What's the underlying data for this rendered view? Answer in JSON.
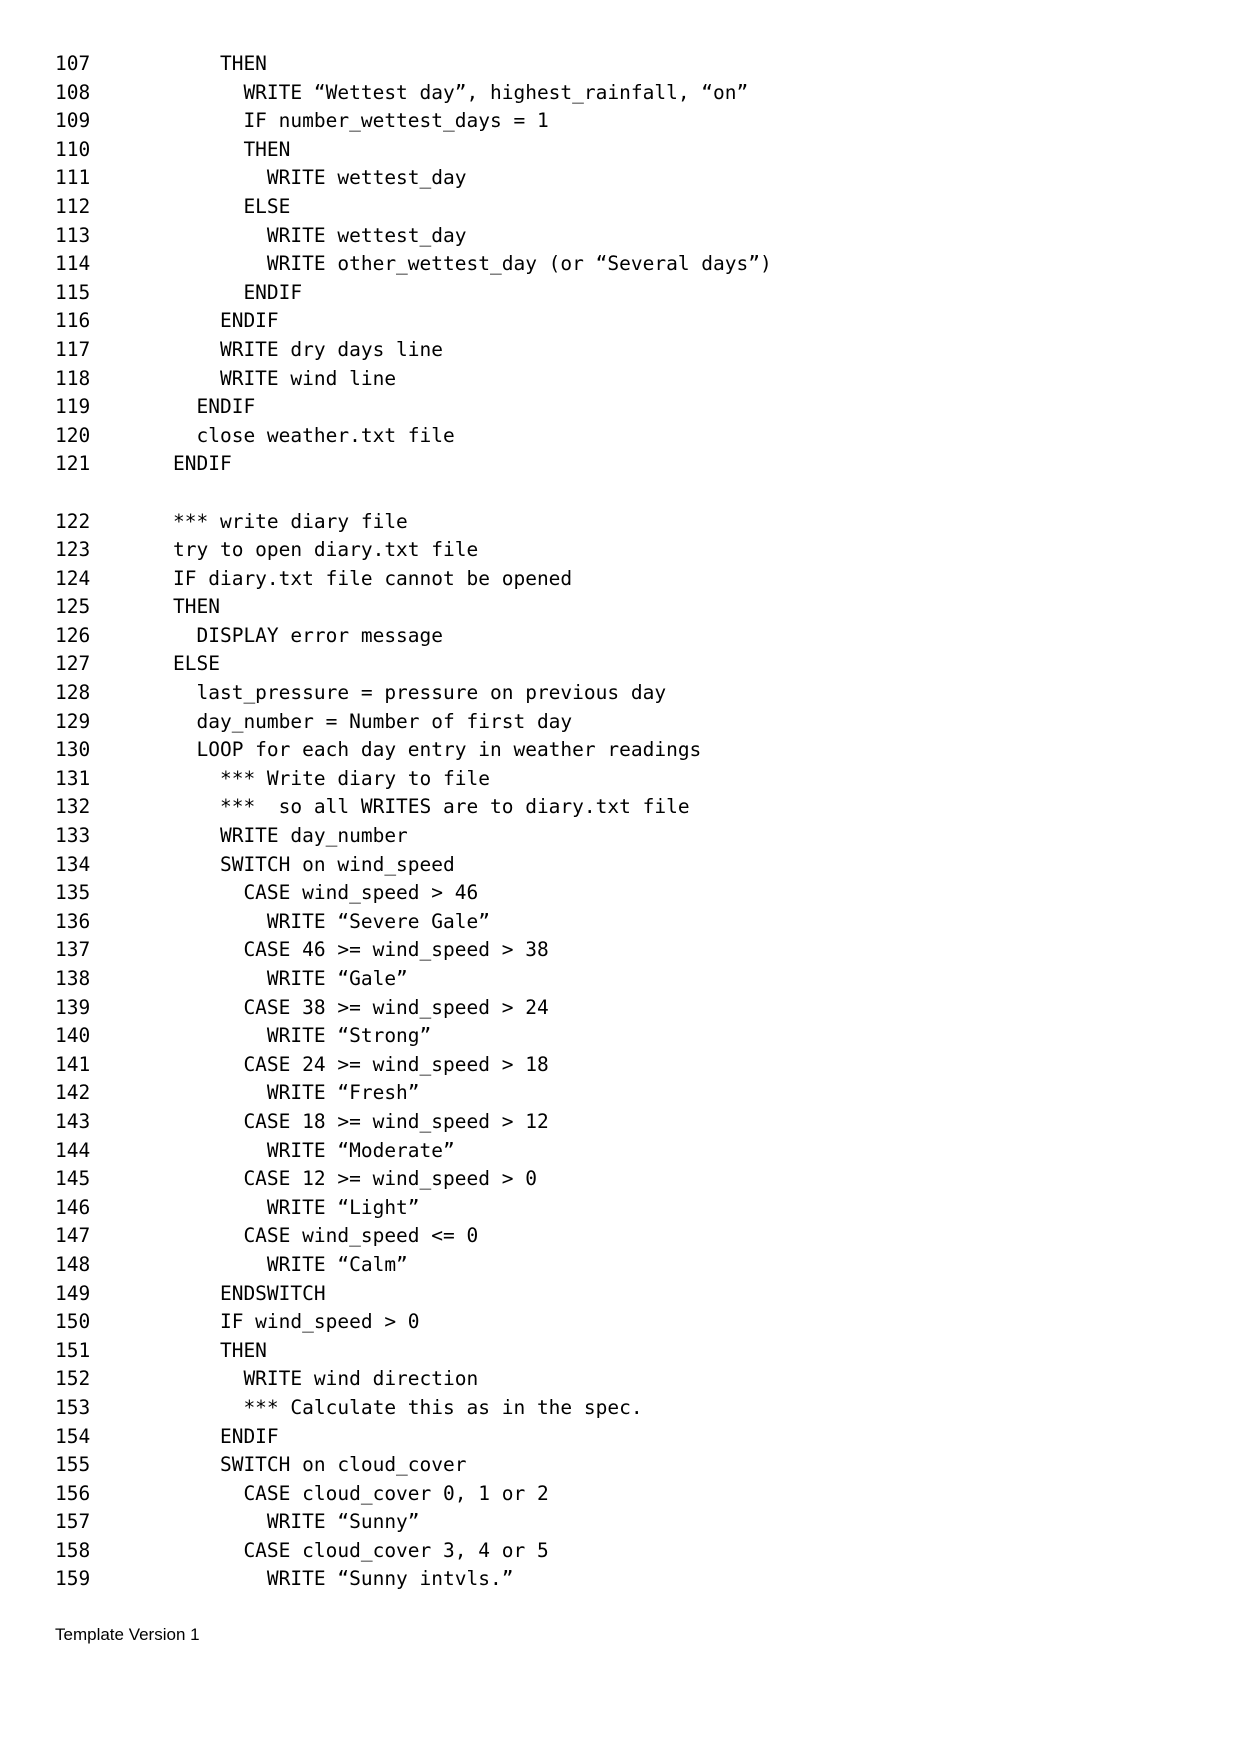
{
  "document": {
    "footer_text": "Template Version 1"
  },
  "listing": {
    "lines": [
      {
        "number": "107",
        "code": "    THEN"
      },
      {
        "number": "108",
        "code": "      WRITE “Wettest day”, highest_rainfall, “on”"
      },
      {
        "number": "109",
        "code": "      IF number_wettest_days = 1"
      },
      {
        "number": "110",
        "code": "      THEN"
      },
      {
        "number": "111",
        "code": "        WRITE wettest_day"
      },
      {
        "number": "112",
        "code": "      ELSE"
      },
      {
        "number": "113",
        "code": "        WRITE wettest_day"
      },
      {
        "number": "114",
        "code": "        WRITE other_wettest_day (or “Several days”)"
      },
      {
        "number": "115",
        "code": "      ENDIF"
      },
      {
        "number": "116",
        "code": "    ENDIF"
      },
      {
        "number": "117",
        "code": "    WRITE dry days line"
      },
      {
        "number": "118",
        "code": "    WRITE wind line"
      },
      {
        "number": "119",
        "code": "  ENDIF"
      },
      {
        "number": "120",
        "code": "  close weather.txt file"
      },
      {
        "number": "121",
        "code": "ENDIF"
      },
      {
        "number": "",
        "code": ""
      },
      {
        "number": "122",
        "code": "*** write diary file"
      },
      {
        "number": "123",
        "code": "try to open diary.txt file"
      },
      {
        "number": "124",
        "code": "IF diary.txt file cannot be opened"
      },
      {
        "number": "125",
        "code": "THEN"
      },
      {
        "number": "126",
        "code": "  DISPLAY error message"
      },
      {
        "number": "127",
        "code": "ELSE"
      },
      {
        "number": "128",
        "code": "  last_pressure = pressure on previous day"
      },
      {
        "number": "129",
        "code": "  day_number = Number of first day"
      },
      {
        "number": "130",
        "code": "  LOOP for each day entry in weather readings"
      },
      {
        "number": "131",
        "code": "    *** Write diary to file"
      },
      {
        "number": "132",
        "code": "    ***  so all WRITES are to diary.txt file"
      },
      {
        "number": "133",
        "code": "    WRITE day_number"
      },
      {
        "number": "134",
        "code": "    SWITCH on wind_speed"
      },
      {
        "number": "135",
        "code": "      CASE wind_speed > 46"
      },
      {
        "number": "136",
        "code": "        WRITE “Severe Gale”"
      },
      {
        "number": "137",
        "code": "      CASE 46 >= wind_speed > 38"
      },
      {
        "number": "138",
        "code": "        WRITE “Gale”"
      },
      {
        "number": "139",
        "code": "      CASE 38 >= wind_speed > 24"
      },
      {
        "number": "140",
        "code": "        WRITE “Strong”"
      },
      {
        "number": "141",
        "code": "      CASE 24 >= wind_speed > 18"
      },
      {
        "number": "142",
        "code": "        WRITE “Fresh”"
      },
      {
        "number": "143",
        "code": "      CASE 18 >= wind_speed > 12"
      },
      {
        "number": "144",
        "code": "        WRITE “Moderate”"
      },
      {
        "number": "145",
        "code": "      CASE 12 >= wind_speed > 0"
      },
      {
        "number": "146",
        "code": "        WRITE “Light”"
      },
      {
        "number": "147",
        "code": "      CASE wind_speed <= 0"
      },
      {
        "number": "148",
        "code": "        WRITE “Calm”"
      },
      {
        "number": "149",
        "code": "    ENDSWITCH"
      },
      {
        "number": "150",
        "code": "    IF wind_speed > 0"
      },
      {
        "number": "151",
        "code": "    THEN"
      },
      {
        "number": "152",
        "code": "      WRITE wind direction"
      },
      {
        "number": "153",
        "code": "      *** Calculate this as in the spec."
      },
      {
        "number": "154",
        "code": "    ENDIF"
      },
      {
        "number": "155",
        "code": "    SWITCH on cloud_cover"
      },
      {
        "number": "156",
        "code": "      CASE cloud_cover 0, 1 or 2"
      },
      {
        "number": "157",
        "code": "        WRITE “Sunny”"
      },
      {
        "number": "158",
        "code": "      CASE cloud_cover 3, 4 or 5"
      },
      {
        "number": "159",
        "code": "        WRITE “Sunny intvls.”"
      }
    ]
  }
}
